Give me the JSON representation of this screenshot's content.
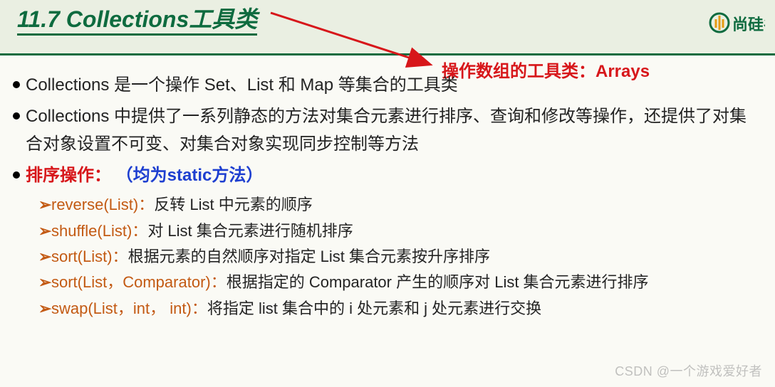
{
  "title": "11.7 Collections工具类",
  "logoText": "尚硅谷",
  "annotation": "操作数组的工具类：Arrays",
  "bullets": [
    {
      "text": "Collections 是一个操作 Set、List 和 Map 等集合的工具类"
    },
    {
      "text": "Collections 中提供了一系列静态的方法对集合元素进行排序、查询和修改等操作，还提供了对集合对象设置不可变、对集合对象实现同步控制等方法"
    }
  ],
  "sortOps": {
    "title": "排序操作：",
    "note": "（均为static方法）",
    "items": [
      {
        "method": "reverse(List)：",
        "desc": "反转 List 中元素的顺序"
      },
      {
        "method": "shuffle(List)：",
        "desc": "对 List 集合元素进行随机排序"
      },
      {
        "method": "sort(List)：",
        "desc": "根据元素的自然顺序对指定 List 集合元素按升序排序"
      },
      {
        "method": "sort(List，Comparator)：",
        "desc": "根据指定的 Comparator 产生的顺序对 List 集合元素进行排序"
      },
      {
        "method": "swap(List，int， int)：",
        "desc": "将指定 list 集合中的 i 处元素和 j 处元素进行交换"
      }
    ]
  },
  "watermark": "CSDN @一个游戏爱好者"
}
